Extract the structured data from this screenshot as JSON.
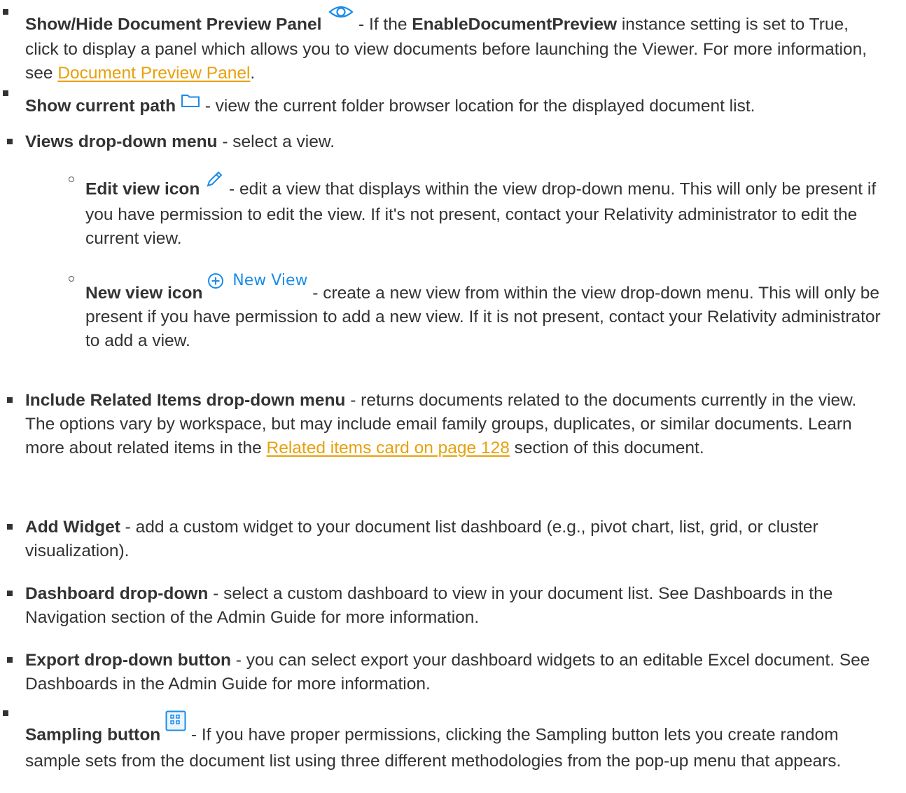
{
  "items": [
    {
      "title": "Show/Hide Document Preview Panel",
      "icon": "eye-icon",
      "text_a": " - If the ",
      "setting": "EnableDocumentPreview",
      "text_b": " instance setting is set to True, click to display a panel which allows you to view documents before launching the Viewer. For more information, see ",
      "link": "Document Preview Panel",
      "text_c": "."
    },
    {
      "title": "Show current path",
      "icon": "folder-icon",
      "text": " - view the current folder browser location for the displayed document list."
    },
    {
      "title": "Views drop-down menu",
      "text": " - select a view."
    },
    {
      "title": "Edit view icon",
      "icon": "pencil-icon",
      "text": " - edit a view that displays within the view drop-down menu. This will only be present if you have permission to edit the view. If it's not present, contact your Relativity administrator to edit the current view."
    },
    {
      "title": "New view icon",
      "icon": "plus-circle-icon",
      "icon_label": "New View",
      "text": " - create a new view from within the view drop-down menu. This will only be present if you have permission to add a new view. If it is not present, contact your Relativity administrator to add a view."
    },
    {
      "title": "Include Related Items drop-down menu",
      "text_a": " - returns documents related to the documents currently in the view. The options vary by workspace, but may include email family groups, duplicates, or similar documents. Learn more about related items in the ",
      "link": "Related items card on page 128",
      "text_b": " section of this document."
    },
    {
      "title": "Add Widget",
      "text": " - add a custom widget to your document list dashboard (e.g., pivot chart, list, grid, or cluster visualization)."
    },
    {
      "title": "Dashboard drop-down",
      "text": " - select a custom dashboard to view in your document list. See Dashboards in the Navigation section of the Admin Guide for more information."
    },
    {
      "title": "Export drop-down button",
      "text": " - you can select export your dashboard widgets to an editable Excel document. See Dashboards in the Admin Guide for more information."
    },
    {
      "title": "Sampling button",
      "icon": "sampling-icon",
      "text": " - If you have proper permissions, clicking the Sampling button lets you create random sample sets from the document list using three different methodologies from the pop-up menu that appears."
    }
  ],
  "colors": {
    "link": "#e8a00c",
    "icon_blue": "#1b8cea",
    "text": "#333333"
  }
}
